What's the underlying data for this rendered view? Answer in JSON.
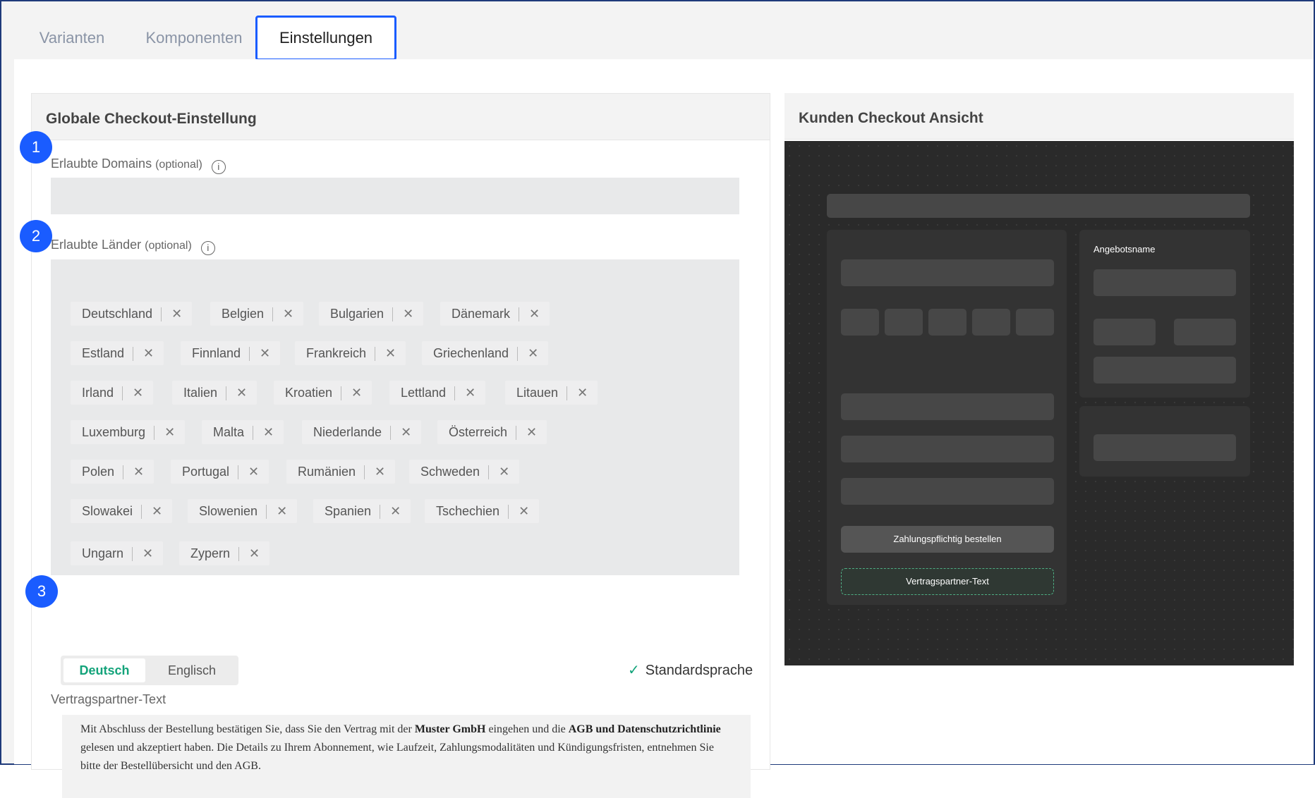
{
  "tabs": [
    {
      "label": "Varianten",
      "active": false
    },
    {
      "label": "Komponenten",
      "active": false
    },
    {
      "label": "Einstellungen",
      "active": true
    }
  ],
  "left_panel": {
    "title": "Globale Checkout-Einstellung",
    "steps": [
      "1",
      "2",
      "3"
    ],
    "domains": {
      "label": "Erlaubte Domains",
      "optional": "(optional)",
      "value": ""
    },
    "countries": {
      "label": "Erlaubte Länder",
      "optional": "(optional)",
      "selected": [
        "Deutschland",
        "Belgien",
        "Bulgarien",
        "Dänemark",
        "Estland",
        "Finnland",
        "Frankreich",
        "Griechenland",
        "Irland",
        "Italien",
        "Kroatien",
        "Lettland",
        "Litauen",
        "Luxemburg",
        "Malta",
        "Niederlande",
        "Österreich",
        "Polen",
        "Portugal",
        "Rumänien",
        "Schweden",
        "Slowakei",
        "Slowenien",
        "Spanien",
        "Tschechien",
        "Ungarn",
        "Zypern"
      ]
    },
    "languages": {
      "options": [
        "Deutsch",
        "Englisch"
      ],
      "active": "Deutsch",
      "default_label": "Standardsprache"
    },
    "contract_text_label": "Vertragspartner-Text",
    "contract_text": {
      "p1": "Mit Abschluss der Bestellung bestätigen Sie, dass Sie den Vertrag mit der ",
      "b1": "Muster GmbH",
      "p2": " eingehen und die ",
      "b2": "AGB und Datenschutzrichtlinie",
      "p3": " gelesen und akzeptiert haben. Die Details zu Ihrem Abonnement, wie Laufzeit, Zahlungsmodalitäten und Kündigungsfristen, entnehmen Sie bitte der Bestellübersicht und den AGB."
    }
  },
  "right_panel": {
    "title": "Kunden Checkout Ansicht",
    "preview": {
      "offer_name_label": "Angebotsname",
      "order_button": "Zahlungspflichtig bestellen",
      "contract_partner_label": "Vertragspartner-Text"
    }
  },
  "icons": {
    "info": "info-circle-icon",
    "remove": "close-x-icon",
    "check": "check-icon"
  },
  "colors": {
    "accent": "#1a5cff",
    "green": "#13a37a",
    "preview_bg": "#2a2a2a"
  }
}
